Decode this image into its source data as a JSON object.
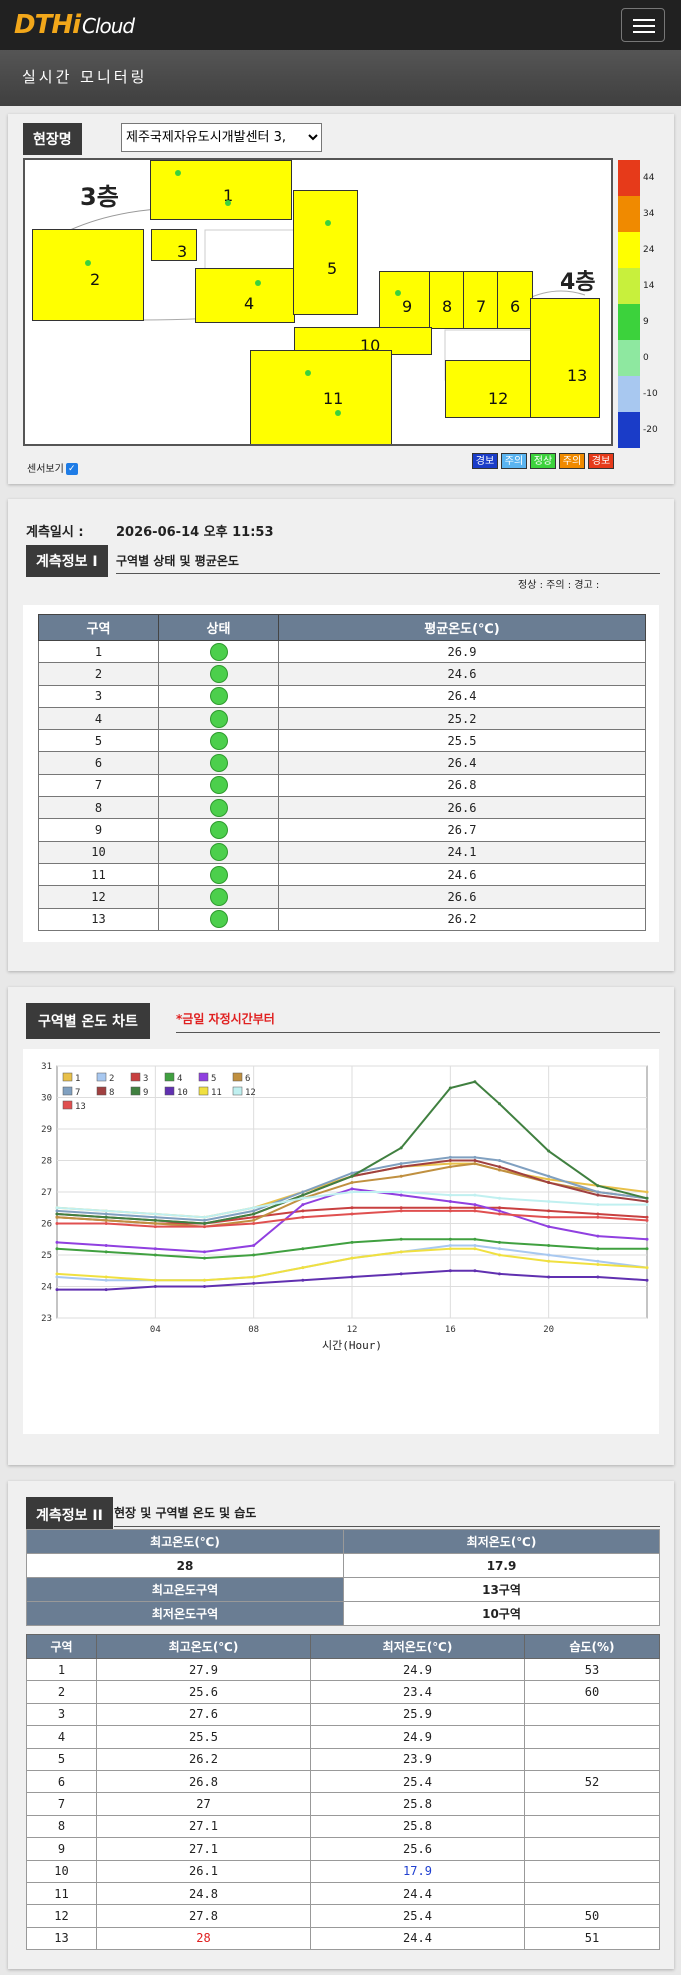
{
  "app": {
    "logo_main": "DTHi",
    "logo_sub": "Cloud",
    "page_title": "실시간 모니터링"
  },
  "site": {
    "label": "현장명",
    "selected": "제주국제자유도시개발센터 3,",
    "sensor_toggle": "센서보기",
    "floor3": "3층",
    "floor4": "4층"
  },
  "zones_plan": [
    "1",
    "2",
    "3",
    "4",
    "5",
    "6",
    "7",
    "8",
    "9",
    "10",
    "11",
    "12",
    "13"
  ],
  "colorbar": {
    "labels": [
      "44",
      "34",
      "24",
      "14",
      "9",
      "0",
      "-10",
      "-20"
    ],
    "colors": [
      "#e63a1a",
      "#f08a00",
      "#ffff00",
      "#c8f03c",
      "#3cd23c",
      "#8ee8a0",
      "#a8c8f0",
      "#1a3cc8"
    ]
  },
  "legend_status": [
    {
      "label": "경보",
      "color": "#1a3cc8"
    },
    {
      "label": "주의",
      "color": "#5ab4f0"
    },
    {
      "label": "정상",
      "color": "#3cd23c"
    },
    {
      "label": "주의",
      "color": "#f08a00"
    },
    {
      "label": "경보",
      "color": "#e63a1a"
    }
  ],
  "measure": {
    "time_label": "계측일시 :",
    "time_value": "2026-06-14 오후 11:53"
  },
  "info1": {
    "title": "계측정보 I",
    "subtitle": "구역별 상태 및 평균온도",
    "legend": "정상 :   주의 :   경고 :",
    "headers": [
      "구역",
      "상태",
      "평균온도(℃)"
    ],
    "rows": [
      {
        "zone": "1",
        "avg": "26.9"
      },
      {
        "zone": "2",
        "avg": "24.6"
      },
      {
        "zone": "3",
        "avg": "26.4"
      },
      {
        "zone": "4",
        "avg": "25.2"
      },
      {
        "zone": "5",
        "avg": "25.5"
      },
      {
        "zone": "6",
        "avg": "26.4"
      },
      {
        "zone": "7",
        "avg": "26.8"
      },
      {
        "zone": "8",
        "avg": "26.6"
      },
      {
        "zone": "9",
        "avg": "26.7"
      },
      {
        "zone": "10",
        "avg": "24.1"
      },
      {
        "zone": "11",
        "avg": "24.6"
      },
      {
        "zone": "12",
        "avg": "26.6"
      },
      {
        "zone": "13",
        "avg": "26.2"
      }
    ]
  },
  "chart_section": {
    "title": "구역별 온도 차트",
    "note": "*금일 자정시간부터"
  },
  "chart_data": {
    "type": "line",
    "xlabel": "시간(Hour)",
    "ylabel": "",
    "xlim": [
      0,
      24
    ],
    "ylim": [
      23,
      31
    ],
    "xticks": [
      "04",
      "08",
      "12",
      "16",
      "20"
    ],
    "yticks": [
      "23",
      "24",
      "25",
      "26",
      "27",
      "28",
      "29",
      "30",
      "31"
    ],
    "grid": true,
    "legend": "top-left",
    "x": [
      0,
      2,
      4,
      6,
      8,
      10,
      12,
      14,
      16,
      17,
      18,
      20,
      22,
      24
    ],
    "series": [
      {
        "name": "1",
        "color": "#e8c04a",
        "values": [
          26.5,
          26.4,
          26.3,
          26.2,
          26.5,
          27.0,
          27.5,
          27.8,
          27.9,
          27.9,
          27.7,
          27.4,
          27.2,
          27.0
        ]
      },
      {
        "name": "2",
        "color": "#a8c8f0",
        "values": [
          24.3,
          24.2,
          24.2,
          24.2,
          24.3,
          24.6,
          24.9,
          25.1,
          25.3,
          25.3,
          25.2,
          25.0,
          24.8,
          24.6
        ]
      },
      {
        "name": "3",
        "color": "#c84040",
        "values": [
          26.2,
          26.1,
          26.0,
          26.0,
          26.2,
          26.4,
          26.5,
          26.5,
          26.5,
          26.5,
          26.5,
          26.4,
          26.3,
          26.2
        ]
      },
      {
        "name": "4",
        "color": "#40a040",
        "values": [
          25.2,
          25.1,
          25.0,
          24.9,
          25.0,
          25.2,
          25.4,
          25.5,
          25.5,
          25.5,
          25.4,
          25.3,
          25.2,
          25.2
        ]
      },
      {
        "name": "5",
        "color": "#9040e0",
        "values": [
          25.4,
          25.3,
          25.2,
          25.1,
          25.3,
          26.6,
          27.1,
          26.9,
          26.7,
          26.6,
          26.4,
          25.9,
          25.6,
          25.5
        ]
      },
      {
        "name": "6",
        "color": "#c09040",
        "values": [
          26.2,
          26.1,
          26.0,
          25.9,
          26.1,
          26.8,
          27.3,
          27.5,
          27.8,
          27.9,
          27.7,
          27.3,
          27.0,
          26.8
        ]
      },
      {
        "name": "7",
        "color": "#80a0c0",
        "values": [
          26.4,
          26.3,
          26.2,
          26.1,
          26.4,
          27.0,
          27.6,
          27.9,
          28.1,
          28.1,
          28.0,
          27.5,
          27.0,
          26.8
        ]
      },
      {
        "name": "8",
        "color": "#a04040",
        "values": [
          26.3,
          26.2,
          26.1,
          26.0,
          26.3,
          26.9,
          27.5,
          27.8,
          28.0,
          28.0,
          27.8,
          27.3,
          26.9,
          26.7
        ]
      },
      {
        "name": "9",
        "color": "#408040",
        "values": [
          26.3,
          26.2,
          26.1,
          26.0,
          26.3,
          26.9,
          27.5,
          28.4,
          30.3,
          30.5,
          29.8,
          28.3,
          27.2,
          26.8
        ]
      },
      {
        "name": "10",
        "color": "#6030b0",
        "values": [
          23.9,
          23.9,
          24.0,
          24.0,
          24.1,
          24.2,
          24.3,
          24.4,
          24.5,
          24.5,
          24.4,
          24.3,
          24.3,
          24.2
        ]
      },
      {
        "name": "11",
        "color": "#f0e040",
        "values": [
          24.4,
          24.3,
          24.2,
          24.2,
          24.3,
          24.6,
          24.9,
          25.1,
          25.2,
          25.2,
          25.0,
          24.8,
          24.7,
          24.6
        ]
      },
      {
        "name": "12",
        "color": "#c0f0f0",
        "values": [
          26.5,
          26.4,
          26.3,
          26.2,
          26.5,
          26.8,
          27.0,
          27.0,
          26.9,
          26.9,
          26.8,
          26.7,
          26.6,
          26.6
        ]
      },
      {
        "name": "13",
        "color": "#e05050",
        "values": [
          26.0,
          26.0,
          25.9,
          25.9,
          26.0,
          26.2,
          26.3,
          26.4,
          26.4,
          26.4,
          26.3,
          26.2,
          26.2,
          26.1
        ]
      }
    ]
  },
  "info2": {
    "title": "계측정보 II",
    "subtitle": "현장 및 구역별 온도 및 습도",
    "max_label": "최고온도(℃)",
    "min_label": "최저온도(℃)",
    "max_value": "28",
    "min_value": "17.9",
    "max_zone_label": "최고온도구역",
    "max_zone_value": "13구역",
    "min_zone_label": "최저온도구역",
    "min_zone_value": "10구역",
    "headers": [
      "구역",
      "최고온도(℃)",
      "최저온도(℃)",
      "습도(%)"
    ],
    "rows": [
      {
        "zone": "1",
        "max": "27.9",
        "min": "24.9",
        "hum": "53"
      },
      {
        "zone": "2",
        "max": "25.6",
        "min": "23.4",
        "hum": "60"
      },
      {
        "zone": "3",
        "max": "27.6",
        "min": "25.9",
        "hum": ""
      },
      {
        "zone": "4",
        "max": "25.5",
        "min": "24.9",
        "hum": ""
      },
      {
        "zone": "5",
        "max": "26.2",
        "min": "23.9",
        "hum": ""
      },
      {
        "zone": "6",
        "max": "26.8",
        "min": "25.4",
        "hum": "52"
      },
      {
        "zone": "7",
        "max": "27",
        "min": "25.8",
        "hum": ""
      },
      {
        "zone": "8",
        "max": "27.1",
        "min": "25.8",
        "hum": ""
      },
      {
        "zone": "9",
        "max": "27.1",
        "min": "25.6",
        "hum": ""
      },
      {
        "zone": "10",
        "max": "26.1",
        "min": "17.9",
        "hum": ""
      },
      {
        "zone": "11",
        "max": "24.8",
        "min": "24.4",
        "hum": ""
      },
      {
        "zone": "12",
        "max": "27.8",
        "min": "25.4",
        "hum": "50"
      },
      {
        "zone": "13",
        "max": "28",
        "min": "24.4",
        "hum": "51"
      }
    ],
    "highlight_max_color": "#e02020",
    "highlight_min_color": "#2040d0"
  }
}
